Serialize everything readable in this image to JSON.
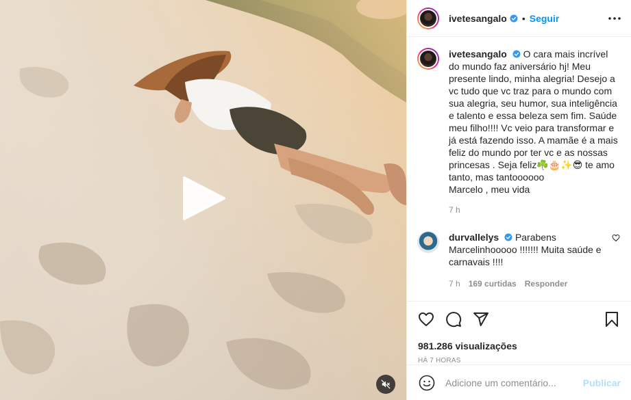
{
  "post": {
    "username": "ivetesangalo",
    "follow_label": "Seguir",
    "separator": "•"
  },
  "caption": {
    "author": "ivetesangalo",
    "text": "O cara mais incrível do mundo faz aniversário hj! Meu presente lindo, minha alegria! Desejo a vc tudo que vc traz para o mundo com sua alegria, seu humor, sua inteligência e talento e essa beleza sem fim. Saúde meu filho!!!! Vc veio para transformar e já está fazendo isso. A mamãe é a mais feliz do mundo por ter vc e as nossas princesas . Seja feliz☘️🎂✨😎 te amo tanto, mas tantoooooo",
    "signoff": "Marcelo , meu vida",
    "time": "7 h"
  },
  "comment": {
    "author": "durvallelys",
    "text": "Parabens Marcelinhooooo !!!!!!! Muita saúde e carnavais !!!!",
    "time": "7 h",
    "likes": "169 curtidas",
    "reply_label": "Responder"
  },
  "stats": {
    "views": "981.286 visualizações",
    "posted_ago": "HÁ 7 HORAS"
  },
  "composer": {
    "placeholder": "Adicione um comentário...",
    "publish_label": "Publicar"
  },
  "icons": {
    "like": "heart-icon",
    "comment": "comment-icon",
    "share": "paper-plane-icon",
    "save": "bookmark-icon",
    "more": "more-horizontal-icon",
    "play": "play-icon",
    "mute": "speaker-muted-icon",
    "emoji": "emoji-icon",
    "verified": "verified-badge-icon"
  },
  "colors": {
    "accent": "#0095f6",
    "verified": "#3897f0",
    "publish_disabled": "#b2dffc",
    "muted_text": "#8e8e8e"
  }
}
